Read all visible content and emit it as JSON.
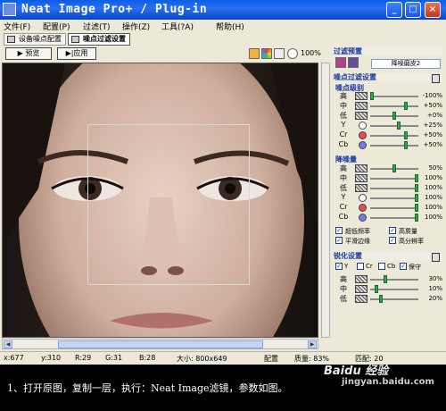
{
  "window": {
    "title": "Neat Image Pro+ / Plug-in"
  },
  "titlebar_buttons": {
    "minimize": "_",
    "maximize": "□",
    "close": "×"
  },
  "menu": [
    {
      "label": "文件(F)"
    },
    {
      "label": "配置(P)"
    },
    {
      "label": "过滤(T)"
    },
    {
      "label": "操作(Z)"
    },
    {
      "label": "工具(?A)"
    },
    {
      "label": "帮助(H)"
    }
  ],
  "modes": {
    "device_profile": "设备噪点配置",
    "noise_filter": "噪点过滤设置"
  },
  "toolbar": {
    "preview": "▶ 预览",
    "apply": "▶|应用",
    "zoom": "100%"
  },
  "status": {
    "x": "x:677",
    "y": "y:310",
    "r": "R:29",
    "g": "G:31",
    "b": "B:28",
    "size": "大小: 800x649",
    "profile": "配置",
    "quality": "质量: 83%",
    "tail": "匹配: 20"
  },
  "panel": {
    "preset_header": "过滤预置",
    "preset_value": "降噪磨皮2",
    "noise_filter_header": "噪点过滤设置",
    "noise_level_header": "噪点级别",
    "noise_level_rows": [
      {
        "label": "高",
        "value": "-100%",
        "pos": 0.0
      },
      {
        "label": "中",
        "value": "+50%",
        "pos": 0.75
      },
      {
        "label": "低",
        "value": "+0%",
        "pos": 0.5
      },
      {
        "label": "Y",
        "value": "+25%",
        "pos": 0.6
      },
      {
        "label": "Cr",
        "value": "+50%",
        "pos": 0.75
      },
      {
        "label": "Cb",
        "value": "+50%",
        "pos": 0.75
      }
    ],
    "noise_reduce_header": "降噪量",
    "noise_reduce_rows": [
      {
        "label": "高",
        "value": "50%",
        "pos": 0.5
      },
      {
        "label": "中",
        "value": "100%",
        "pos": 1.0
      },
      {
        "label": "低",
        "value": "100%",
        "pos": 1.0
      },
      {
        "label": "Y",
        "value": "100%",
        "pos": 1.0
      },
      {
        "label": "Cr",
        "value": "100%",
        "pos": 1.0
      },
      {
        "label": "Cb",
        "value": "100%",
        "pos": 1.0
      }
    ],
    "checkboxes": [
      {
        "label": "超低频率",
        "checked": true
      },
      {
        "label": "高质量",
        "checked": true
      },
      {
        "label": "平滑边缘",
        "checked": true
      },
      {
        "label": "高分辨率",
        "checked": true
      }
    ],
    "sharpen_header": "锐化设置",
    "sharpen_channels": [
      {
        "label": "Y",
        "checked": true
      },
      {
        "label": "Cr",
        "checked": false
      },
      {
        "label": "Cb",
        "checked": false
      },
      {
        "label": "保守",
        "checked": true
      }
    ],
    "sharpen_rows": [
      {
        "label": "高",
        "value": "30%",
        "pos": 0.3
      },
      {
        "label": "中",
        "value": "10%",
        "pos": 0.1
      },
      {
        "label": "低",
        "value": "20%",
        "pos": 0.2
      }
    ]
  },
  "caption": "1、打开原图，复制一层，执行：Neat Image滤镜，参数如图。",
  "watermark": {
    "line1": "Baidu 经验",
    "line2": "jingyan.baidu.com"
  },
  "colors": {
    "titlebar": "#0a5de6",
    "accent": "#12379e",
    "slider_knob": "#2fa84a"
  }
}
